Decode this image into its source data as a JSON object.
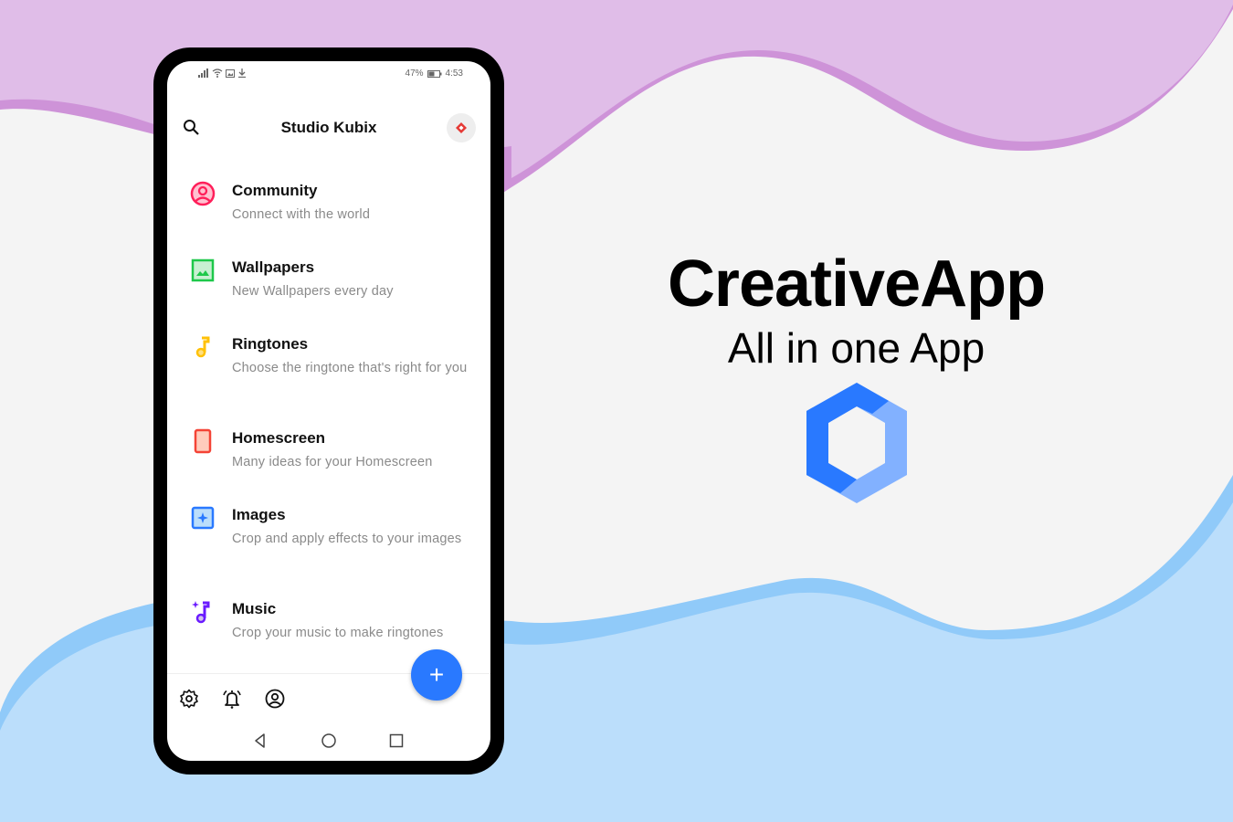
{
  "colors": {
    "accent": "#2979ff",
    "wave_purple_light": "#e0bde8",
    "wave_purple_dark": "#ce93d8",
    "wave_blue_light": "#bbdefb",
    "wave_blue_dark": "#90caf9"
  },
  "status_bar": {
    "icons": [
      "signal-icon",
      "wifi-icon",
      "image-notification-icon",
      "download-icon"
    ],
    "battery": "47%",
    "time": "4:53"
  },
  "app_bar": {
    "title": "Studio Kubix",
    "search_icon": "search-icon",
    "logo_icon": "diamond-logo-icon"
  },
  "menu_items": [
    {
      "title": "Community",
      "subtitle": "Connect with the world",
      "icon": "community-icon",
      "color": "#ff1f5a"
    },
    {
      "title": "Wallpapers",
      "subtitle": "New Wallpapers every day",
      "icon": "wallpaper-icon",
      "color": "#1ec84a"
    },
    {
      "title": "Ringtones",
      "subtitle": "Choose the ringtone that's right for you",
      "icon": "music-note-icon",
      "color": "#ffc107"
    },
    {
      "title": "Homescreen",
      "subtitle": "Many ideas for your Homescreen",
      "icon": "homescreen-icon",
      "color": "#f44336"
    },
    {
      "title": "Images",
      "subtitle": "Crop and apply effects to your images",
      "icon": "images-icon",
      "color": "#2979ff"
    },
    {
      "title": "Music",
      "subtitle": "Crop your music to make ringtones",
      "icon": "music-sparkle-icon",
      "color": "#6a1bff"
    }
  ],
  "fab": {
    "label": "+",
    "icon": "plus-icon"
  },
  "bottom_bar": {
    "icons": [
      "settings-icon",
      "alarm-icon",
      "account-icon"
    ]
  },
  "nav_bar": {
    "icons": [
      "back-icon",
      "home-icon",
      "recents-icon"
    ]
  },
  "hero": {
    "title": "CreativeApp",
    "subtitle": "All in one App",
    "logo": "hexagon-logo-icon"
  }
}
